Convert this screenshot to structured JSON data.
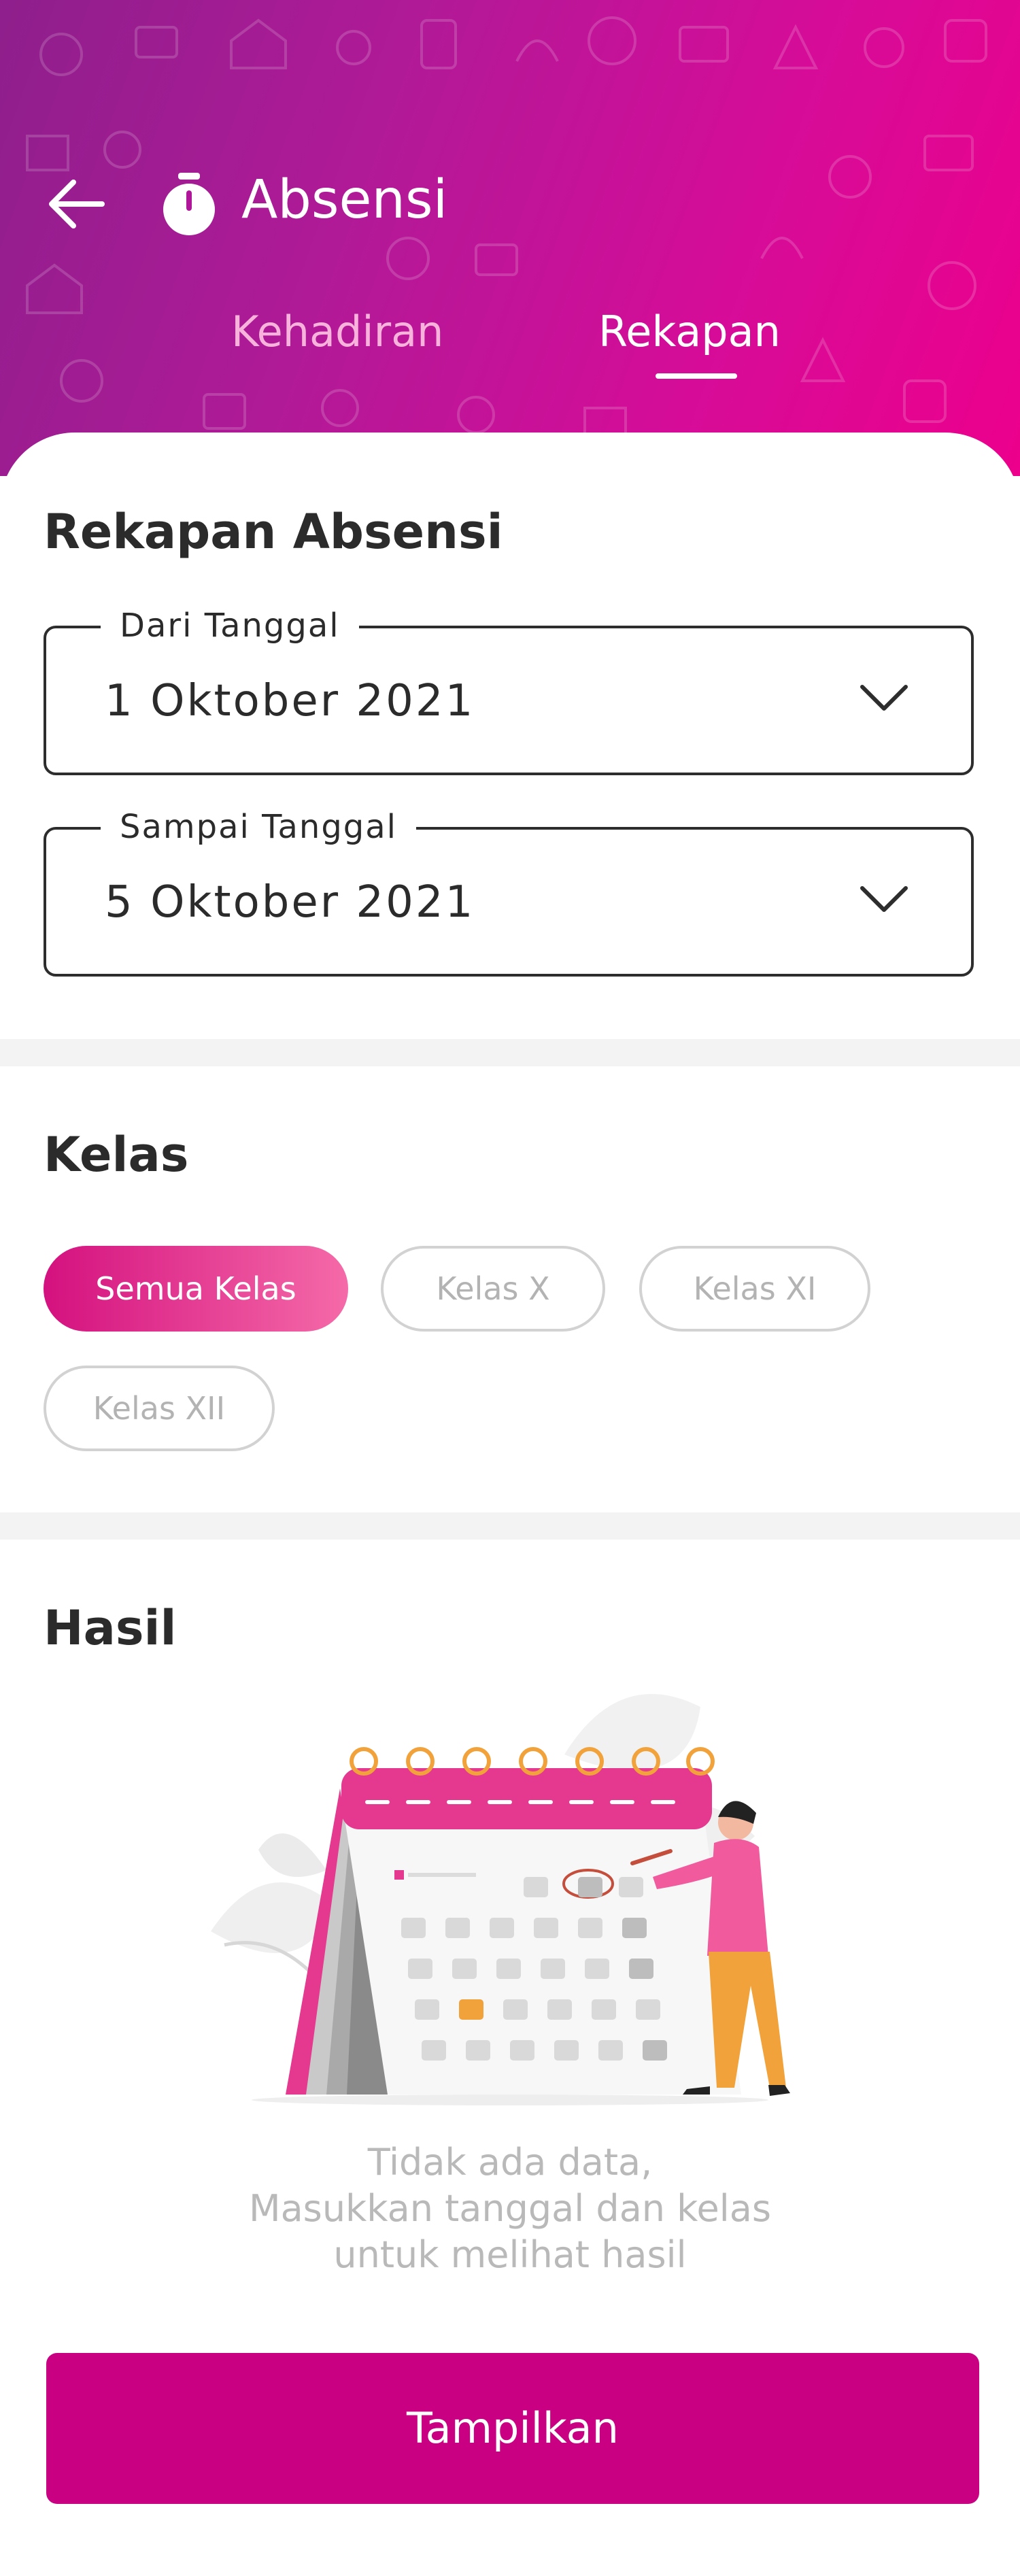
{
  "header": {
    "back_icon": "arrow-left-icon",
    "title_icon": "stopwatch-icon",
    "title": "Absensi",
    "tabs": [
      {
        "label": "Kehadiran",
        "active": false
      },
      {
        "label": "Rekapan",
        "active": true
      }
    ],
    "gradient_colors": [
      "#8e1f8c",
      "#d60c98",
      "#ec008c"
    ]
  },
  "rekap": {
    "title": "Rekapan Absensi",
    "from": {
      "label": "Dari Tanggal",
      "value": "1 Oktober 2021",
      "icon": "chevron-down-icon"
    },
    "to": {
      "label": "Sampai Tanggal",
      "value": "5 Oktober 2021",
      "icon": "chevron-down-icon"
    }
  },
  "kelas": {
    "title": "Kelas",
    "chips": [
      {
        "label": "Semua Kelas",
        "selected": true
      },
      {
        "label": "Kelas  X",
        "selected": false
      },
      {
        "label": "Kelas XI",
        "selected": false
      },
      {
        "label": "Kelas XII",
        "selected": false
      }
    ]
  },
  "hasil": {
    "title": "Hasil",
    "illustration": "calendar-illustration",
    "empty_lines": [
      "Tidak ada data,",
      "Masukkan tanggal dan kelas",
      "untuk melihat hasil"
    ]
  },
  "button": {
    "label": "Tampilkan"
  },
  "colors": {
    "accent": "#c90082",
    "chip_gradient": [
      "#d4117f",
      "#f56aa8"
    ],
    "muted_text": "#b9b9b9",
    "dark_text": "#2b2b2b"
  }
}
